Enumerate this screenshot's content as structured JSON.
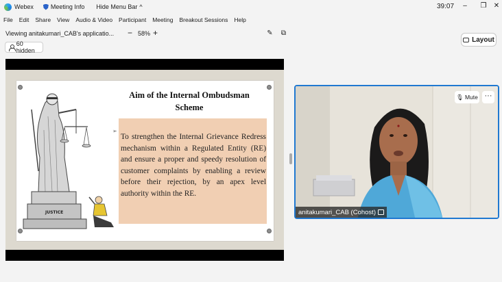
{
  "titlebar": {
    "app_name": "Webex",
    "meeting_info": "Meeting Info",
    "hide_menu": "Hide Menu Bar",
    "timer": "39:07"
  },
  "menu": [
    "File",
    "Edit",
    "Share",
    "View",
    "Audio & Video",
    "Participant",
    "Meeting",
    "Breakout Sessions",
    "Help"
  ],
  "toolbar": {
    "viewing": "Viewing anitakumari_CAB's applicatio...",
    "zoom": "58%",
    "zoom_out": "−",
    "zoom_in": "+"
  },
  "layout_label": "Layout",
  "hidden_label": "60 hidden",
  "slide": {
    "title_line1": "Aim of the Internal Ombudsman",
    "title_line2": "Scheme",
    "body": "To strengthen the Internal Grievance Redress mechanism within a Regulated Entity (RE) and ensure a proper and speedy resolution of customer complaints by enabling a review before their rejection, by an apex level authority within the RE.",
    "statue_label": "JUSTICE"
  },
  "video": {
    "mute_label": "Mute",
    "more": "···",
    "participant_name": "anitakumari_CAB (Cohost)"
  },
  "colors": {
    "active_border": "#1f78d1",
    "slide_box": "#f1cfb3",
    "slide_background": "#ddd9cf"
  }
}
